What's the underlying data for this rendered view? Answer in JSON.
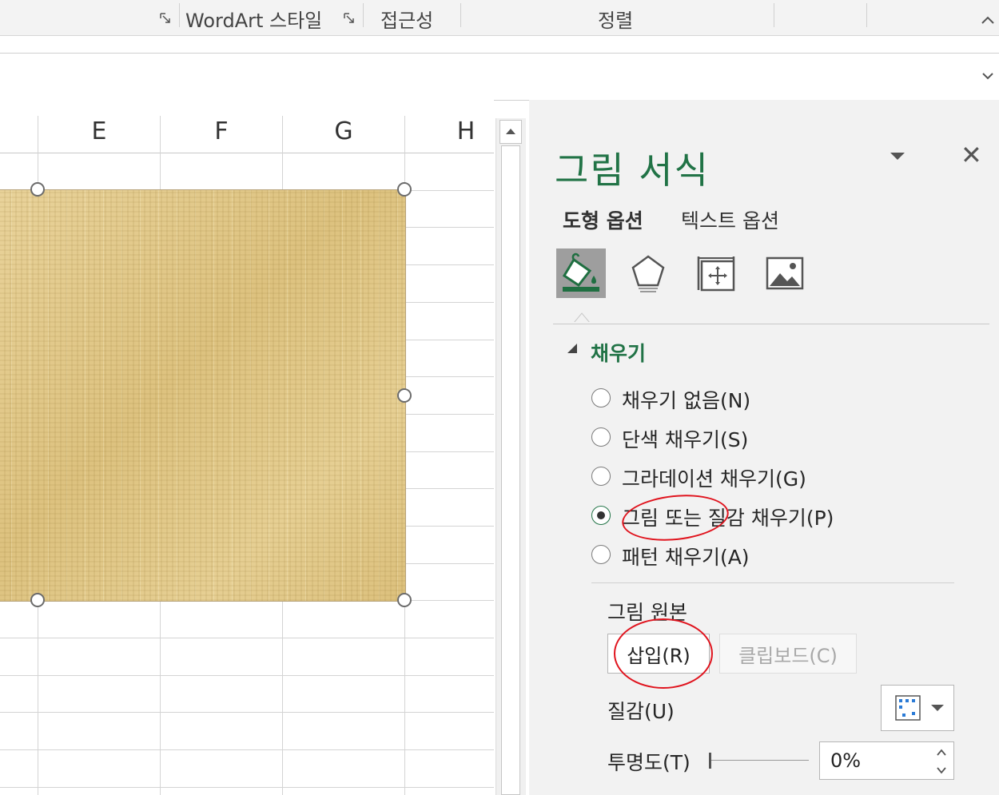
{
  "ribbon": {
    "groups": [
      "WordArt 스타일",
      "접근성",
      "정렬"
    ]
  },
  "sheet": {
    "columns": [
      "E",
      "F",
      "G",
      "H"
    ]
  },
  "pane": {
    "title": "그림 서식",
    "tabs": [
      "도형 옵션",
      "텍스트 옵션"
    ],
    "section": "채우기",
    "fill_options": [
      {
        "label": "채우기 없음(N)",
        "selected": false
      },
      {
        "label": "단색 채우기(S)",
        "selected": false
      },
      {
        "label": "그라데이션 채우기(G)",
        "selected": false
      },
      {
        "label": "그림 또는 질감 채우기(P)",
        "selected": true
      },
      {
        "label": "패턴 채우기(A)",
        "selected": false
      }
    ],
    "picture_source_label": "그림 원본",
    "insert_button": "삽입(R)",
    "clipboard_button": "클립보드(C)",
    "texture_label": "질감(U)",
    "transparency_label": "투명도(T)",
    "transparency_value": "0%"
  },
  "colors": {
    "accent": "#217346",
    "annotation": "#e0141e"
  },
  "icons": [
    "fill-bucket-icon",
    "pentagon-effects-icon",
    "size-properties-icon",
    "picture-icon",
    "dialog-launcher-icon",
    "close-icon"
  ]
}
